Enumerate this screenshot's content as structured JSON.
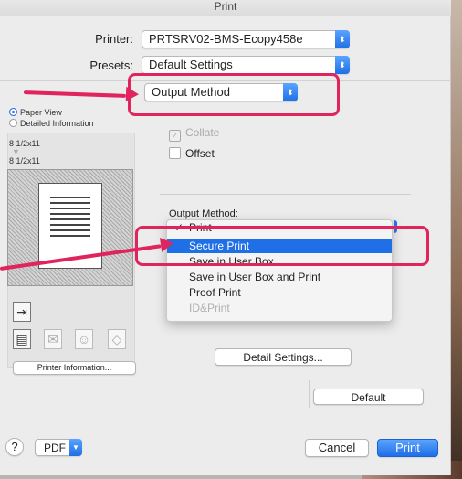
{
  "window": {
    "title": "Print"
  },
  "printer": {
    "label": "Printer:",
    "value": "PRTSRV02-BMS-Ecopy458e"
  },
  "presets": {
    "label": "Presets:",
    "value": "Default Settings"
  },
  "section_popup": {
    "value": "Output Method"
  },
  "left_pane": {
    "view_options": [
      "Paper View",
      "Detailed Information"
    ],
    "selected_view": "Paper View",
    "paper_size_top": "8 1/2x11",
    "paper_size_bottom": "8 1/2x11",
    "printer_info_button": "Printer Information..."
  },
  "options": {
    "collate_label": "Collate",
    "offset_label": "Offset",
    "output_method_label": "Output Method:"
  },
  "output_menu": {
    "items": [
      "Print",
      "Secure Print",
      "Save in User Box",
      "Save in User Box and Print",
      "Proof Print",
      "ID&Print"
    ],
    "checked": "Print",
    "highlighted": "Secure Print",
    "disabled": [
      "ID&Print"
    ]
  },
  "buttons": {
    "detail_settings": "Detail Settings...",
    "default": "Default",
    "help": "?",
    "pdf": "PDF",
    "cancel": "Cancel",
    "print": "Print"
  },
  "colors": {
    "annotation": "#e0245e",
    "accent": "#1f6fe6"
  }
}
